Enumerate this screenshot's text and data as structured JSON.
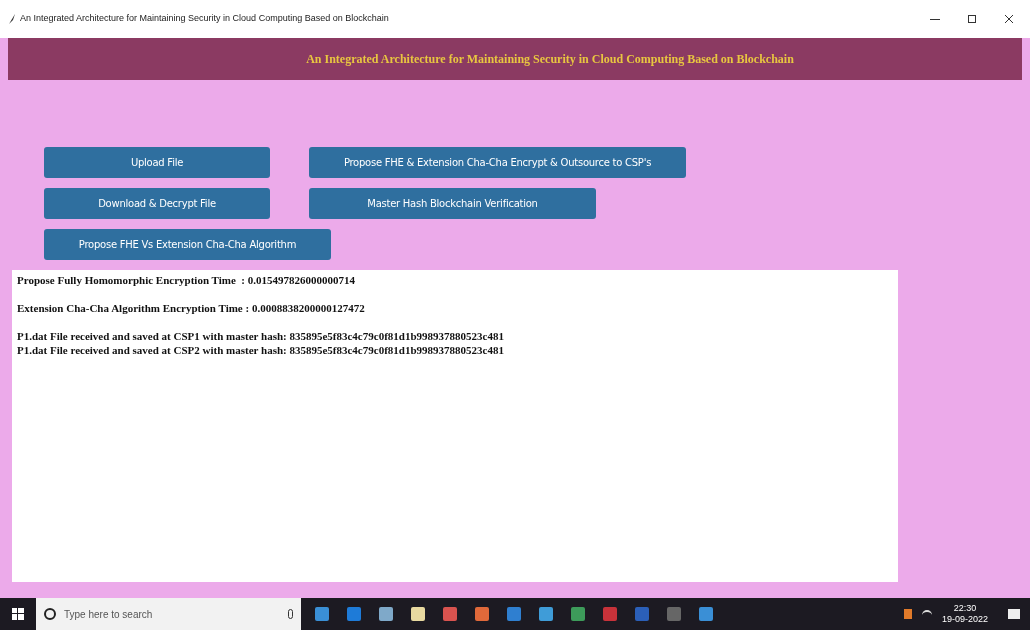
{
  "window": {
    "title": "An Integrated Architecture for Maintaining Security in Cloud Computing Based on Blockchain"
  },
  "header": {
    "title": "An Integrated Architecture for Maintaining Security in Cloud Computing Based on Blockchain"
  },
  "buttons": [
    {
      "label": "Upload File"
    },
    {
      "label": "Propose FHE & Extension Cha-Cha Encrypt & Outsource to CSP's"
    },
    {
      "label": "Download & Decrypt File"
    },
    {
      "label": "Master Hash Blockchain Verification"
    },
    {
      "label": "Propose FHE Vs Extension Cha-Cha Algorithm"
    }
  ],
  "output": {
    "paragraphs": [
      [
        "Propose Fully Homomorphic Encryption Time  : 0.015497826000000714"
      ],
      [
        "Extension Cha-Cha Algorithm Encryption Time : 0.0008838200000127472"
      ],
      [
        "P1.dat File received and saved at CSP1 with master hash: 835895e5f83c4c79c0f81d1b998937880523c481",
        "P1.dat File received and saved at CSP2 with master hash: 835895e5f83c4c79c0f81d1b998937880523c481"
      ]
    ]
  },
  "taskbar": {
    "search": {
      "placeholder": "Type here to search"
    },
    "time": "22:30",
    "date": "19-09-2022"
  }
}
